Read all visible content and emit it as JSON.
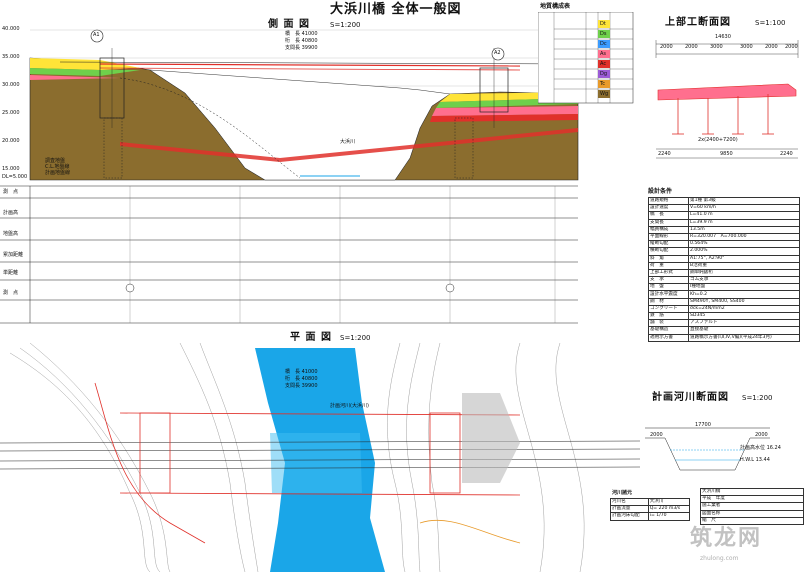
{
  "sheet_title": "大浜川橋 全体一般図",
  "side_view": {
    "title": "側 面 図",
    "scale": "S=1:200",
    "elevations": [
      "40.000",
      "35.000",
      "30.000",
      "25.000",
      "20.000",
      "15.000",
      "10.000",
      "DL=5.000"
    ],
    "abutments": [
      "A1",
      "A2"
    ],
    "lengths": [
      "橋　長 41000",
      "桁　長 40800",
      "支間長 39900"
    ],
    "river_label": "大浜川",
    "legend": [
      "調査地盤",
      "C.L.地盤線",
      "計画地盤線"
    ],
    "row_labels": [
      "測　点",
      "計画高",
      "地盤高",
      "累加距離",
      "単距離",
      "測　点"
    ]
  },
  "soil_table": {
    "title": "地質構成表",
    "codes": [
      "Dt",
      "Ds",
      "Dc",
      "As",
      "Ac",
      "Dg",
      "Tc",
      "Wg"
    ]
  },
  "upper_section": {
    "title": "上部工断面図",
    "scale": "S=1:100",
    "dims": [
      "14630",
      "2000",
      "2000",
      "3000",
      "3000",
      "2000",
      "2000",
      "2240",
      "9850",
      "2240"
    ],
    "note": "2x(2400+7200)"
  },
  "design_conditions": {
    "title": "設計条件",
    "rows": [
      [
        "道路規格",
        "第1種 第3級"
      ],
      [
        "設計速度",
        "V=60 km/h"
      ],
      [
        "橋　長",
        "L=41.0 m"
      ],
      [
        "支間長",
        "L=39.9 m"
      ],
      [
        "幅員構成",
        "13.5m"
      ],
      [
        "平面線形",
        "R=320.007　A=700.000"
      ],
      [
        "縦断勾配",
        "0.564%"
      ],
      [
        "横断勾配",
        "2.000%"
      ],
      [
        "斜　角",
        "A1:75°, A2:90°"
      ],
      [
        "荷　重",
        "B活荷重"
      ],
      [
        "上部工形式",
        "鋼単純鈑桁"
      ],
      [
        "支　承",
        "ゴム支承"
      ],
      [
        "地　盤",
        "Ⅰ種地盤"
      ],
      [
        "設計水平震度",
        "Kh=0.2"
      ],
      [
        "鋼　材",
        "SM490Y, SM400, SS400"
      ],
      [
        "コンクリート",
        "σck=24N/mm2"
      ],
      [
        "鉄　筋",
        "SD345"
      ],
      [
        "舗　装",
        "アスファルト"
      ],
      [
        "基礎構造",
        "直接基礎"
      ],
      [
        "適用示方書",
        "道路橋示方書(Ⅰ,Ⅱ,Ⅳ,Ⅴ編)(平成24年3月)"
      ]
    ]
  },
  "plan_view": {
    "title": "平 面 図",
    "scale": "S=1:200",
    "lengths": [
      "橋　長 41000",
      "桁　長 40800",
      "支間長 39900"
    ],
    "river_label": "計画河川(大浜川)"
  },
  "river_section": {
    "title": "計画河川断面図",
    "scale": "S=1:200",
    "dims": [
      "17700",
      "2000",
      "2000",
      "16.24",
      "13.44"
    ],
    "labels": [
      "計画高水位 16.24",
      "H.W.L 13.44"
    ]
  },
  "river_table": {
    "title": "河川諸元",
    "rows": [
      [
        "河川名",
        "大浜川"
      ],
      [
        "計画流量",
        "Q= 220 m3/s"
      ],
      [
        "計画河床勾配",
        "i= 1/70"
      ]
    ]
  },
  "title_block": {
    "rows": [
      "大浜川橋",
      "平成　年度",
      "施工業者",
      "図面名称",
      "縮　尺"
    ]
  },
  "watermark": {
    "text": "筑龙网",
    "sub": "zhulong.com"
  },
  "colors": {
    "soil_brown": "#8b6d2e",
    "river_blue": "#1aa6e8",
    "red_line": "#e0302a",
    "pink": "#ff6f8e",
    "yellow": "#ffe438",
    "green": "#6fd04b",
    "line": "#222222"
  }
}
